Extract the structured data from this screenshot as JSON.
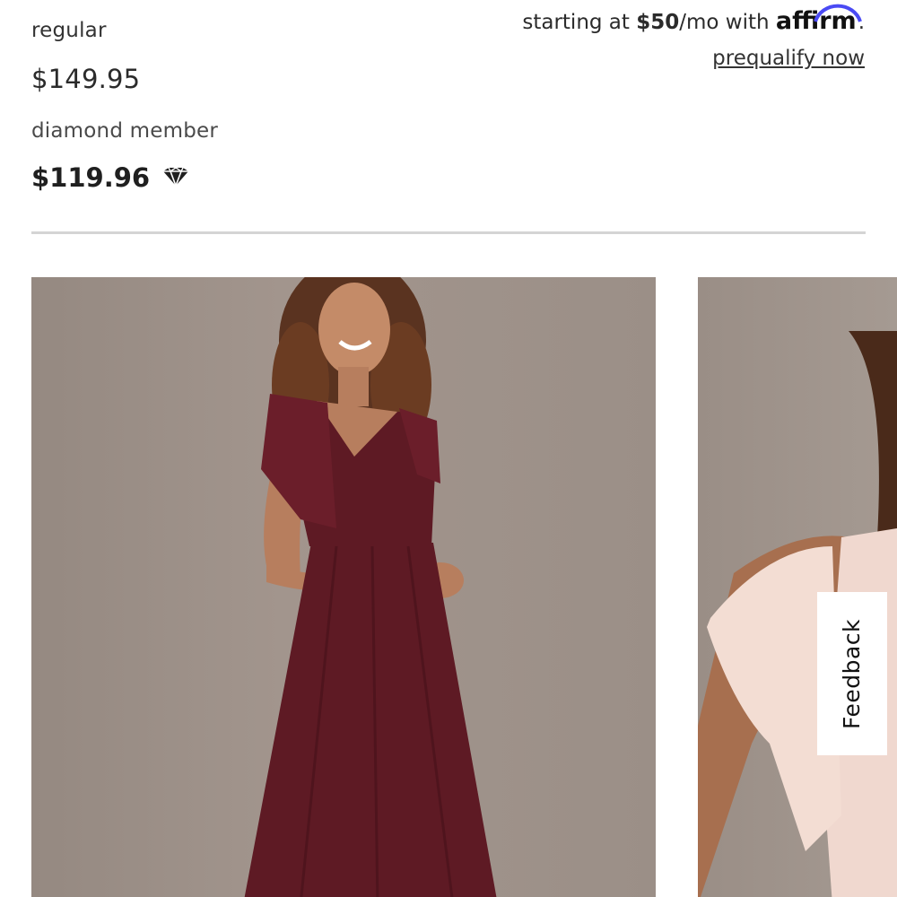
{
  "pricing": {
    "regular_label": "regular",
    "regular_price": "$149.95",
    "member_label": "diamond member",
    "member_price": "$119.96",
    "member_icon": "diamond-icon"
  },
  "financing": {
    "prefix": "starting at ",
    "amount": "$50",
    "suffix": "/mo with ",
    "provider_logo": "affirm",
    "period": ".",
    "prequalify_label": "prequalify now",
    "arc_color": "#4a4af4"
  },
  "gallery": {
    "images": [
      {
        "description": "woman-in-burgundy-flutter-sleeve-dress"
      },
      {
        "description": "woman-in-blush-flutter-sleeve-dress"
      }
    ]
  },
  "feedback": {
    "label": "Feedback"
  },
  "colors": {
    "burgundy": "#5e1a24",
    "blush": "#f0d8cf",
    "backdrop": "#9e928a"
  }
}
